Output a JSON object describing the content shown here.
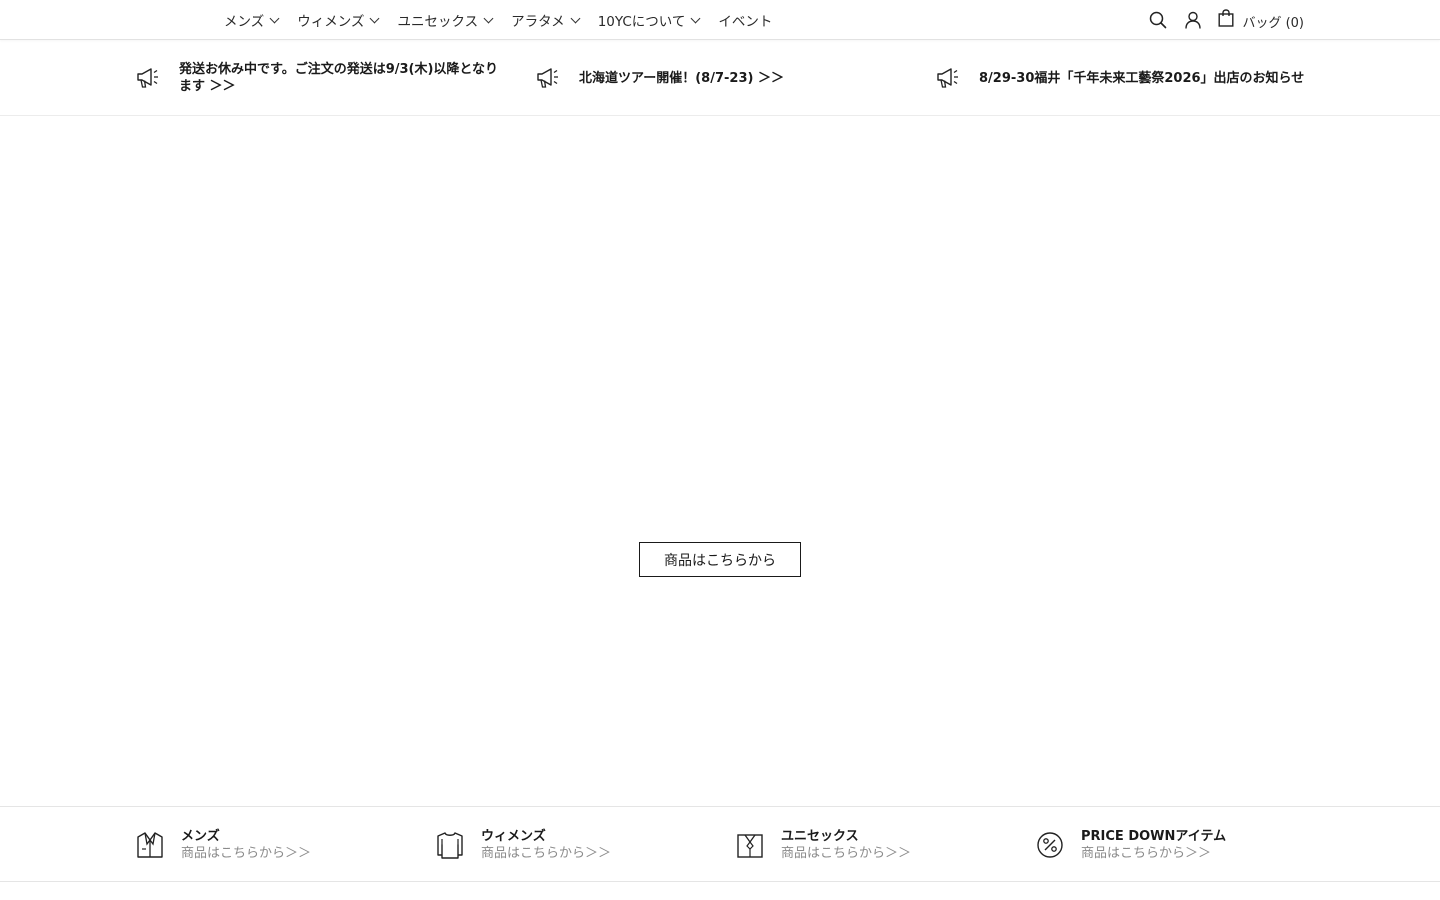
{
  "header": {
    "nav": [
      {
        "label": "メンズ",
        "has_dropdown": true
      },
      {
        "label": "ウィメンズ",
        "has_dropdown": true
      },
      {
        "label": "ユニセックス",
        "has_dropdown": true
      },
      {
        "label": "アラタメ",
        "has_dropdown": true
      },
      {
        "label": "10YCについて",
        "has_dropdown": true
      },
      {
        "label": "イベント",
        "has_dropdown": false
      }
    ],
    "icons": {
      "search": "search-icon",
      "account": "user-icon",
      "bag": "shopping-bag-icon"
    },
    "bag_label": "バッグ (0)"
  },
  "announcements": [
    {
      "icon": "megaphone-icon",
      "text": "発送お休み中です。ご注文の発送は9/3(木)以降となります ＞＞"
    },
    {
      "icon": "megaphone-icon",
      "text": "北海道ツアー開催！(8/7-23) ＞＞"
    },
    {
      "icon": "megaphone-icon",
      "text": "8/29-30福井「千年未来工藝祭2026」出店のお知らせ"
    }
  ],
  "hero": {
    "button_label": "商品はこちらから"
  },
  "categories": [
    {
      "icon": "jacket-icon",
      "title": "メンズ",
      "link": "商品はこちらから＞＞"
    },
    {
      "icon": "sweater-icon",
      "title": "ウィメンズ",
      "link": "商品はこちらから＞＞"
    },
    {
      "icon": "shirt-icon",
      "title": "ユニセックス",
      "link": "商品はこちらから＞＞"
    },
    {
      "icon": "percent-icon",
      "title": "PRICE DOWNアイテム",
      "link": "商品はこちらから＞＞"
    }
  ]
}
